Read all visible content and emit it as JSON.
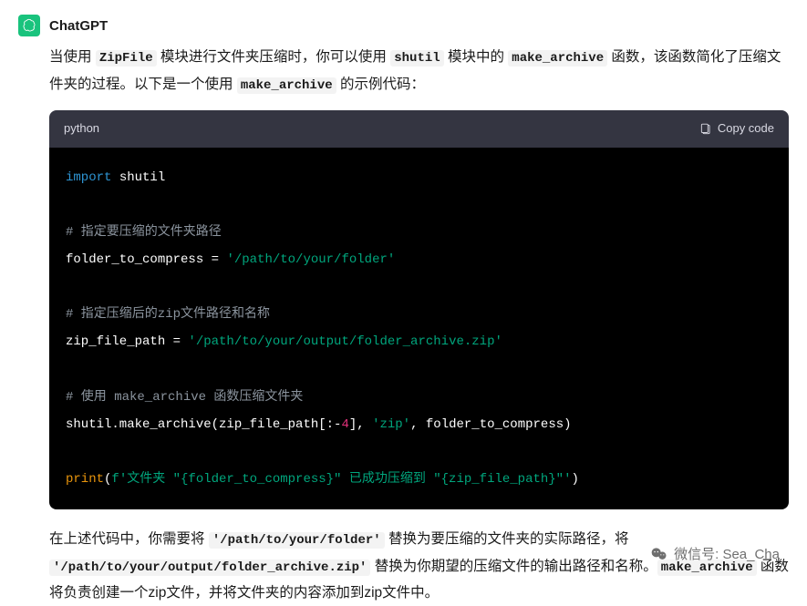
{
  "sender": "ChatGPT",
  "intro": {
    "t1": "当使用 ",
    "c1": "ZipFile",
    "t2": " 模块进行文件夹压缩时，你可以使用 ",
    "c2": "shutil",
    "t3": " 模块中的 ",
    "c3": "make_archive",
    "t4": " 函数，该函数简化了压缩文件夹的过程。以下是一个使用 ",
    "c4": "make_archive",
    "t5": " 的示例代码："
  },
  "code": {
    "lang": "python",
    "copy_label": "Copy code",
    "l1a": "import",
    "l1b": " shutil",
    "l2": "# 指定要压缩的文件夹路径",
    "l3a": "folder_to_compress = ",
    "l3b": "'/path/to/your/folder'",
    "l4": "# 指定压缩后的zip文件路径和名称",
    "l5a": "zip_file_path = ",
    "l5b": "'/path/to/your/output/folder_archive.zip'",
    "l6": "# 使用 make_archive 函数压缩文件夹",
    "l7a": "shutil.make_archive(zip_file_path[:-",
    "l7b": "4",
    "l7c": "], ",
    "l7d": "'zip'",
    "l7e": ", folder_to_compress)",
    "l8a": "print",
    "l8b": "(",
    "l8c": "f'文件夹 \"{folder_to_compress}\" 已成功压缩到 \"{zip_file_path}\"'",
    "l8d": ")"
  },
  "outro": {
    "t1": "在上述代码中，你需要将 ",
    "c1": "'/path/to/your/folder'",
    "t2": " 替换为要压缩的文件夹的实际路径，将 ",
    "c2": "'/path/to/your/output/folder_archive.zip'",
    "t3": " 替换为你期望的压缩文件的输出路径和名称。",
    "c3": "make_archive",
    "t4": " 函数将负责创建一个zip文件，并将文件夹的内容添加到zip文件中。"
  },
  "watermark": "微信号: Sea_Cha"
}
